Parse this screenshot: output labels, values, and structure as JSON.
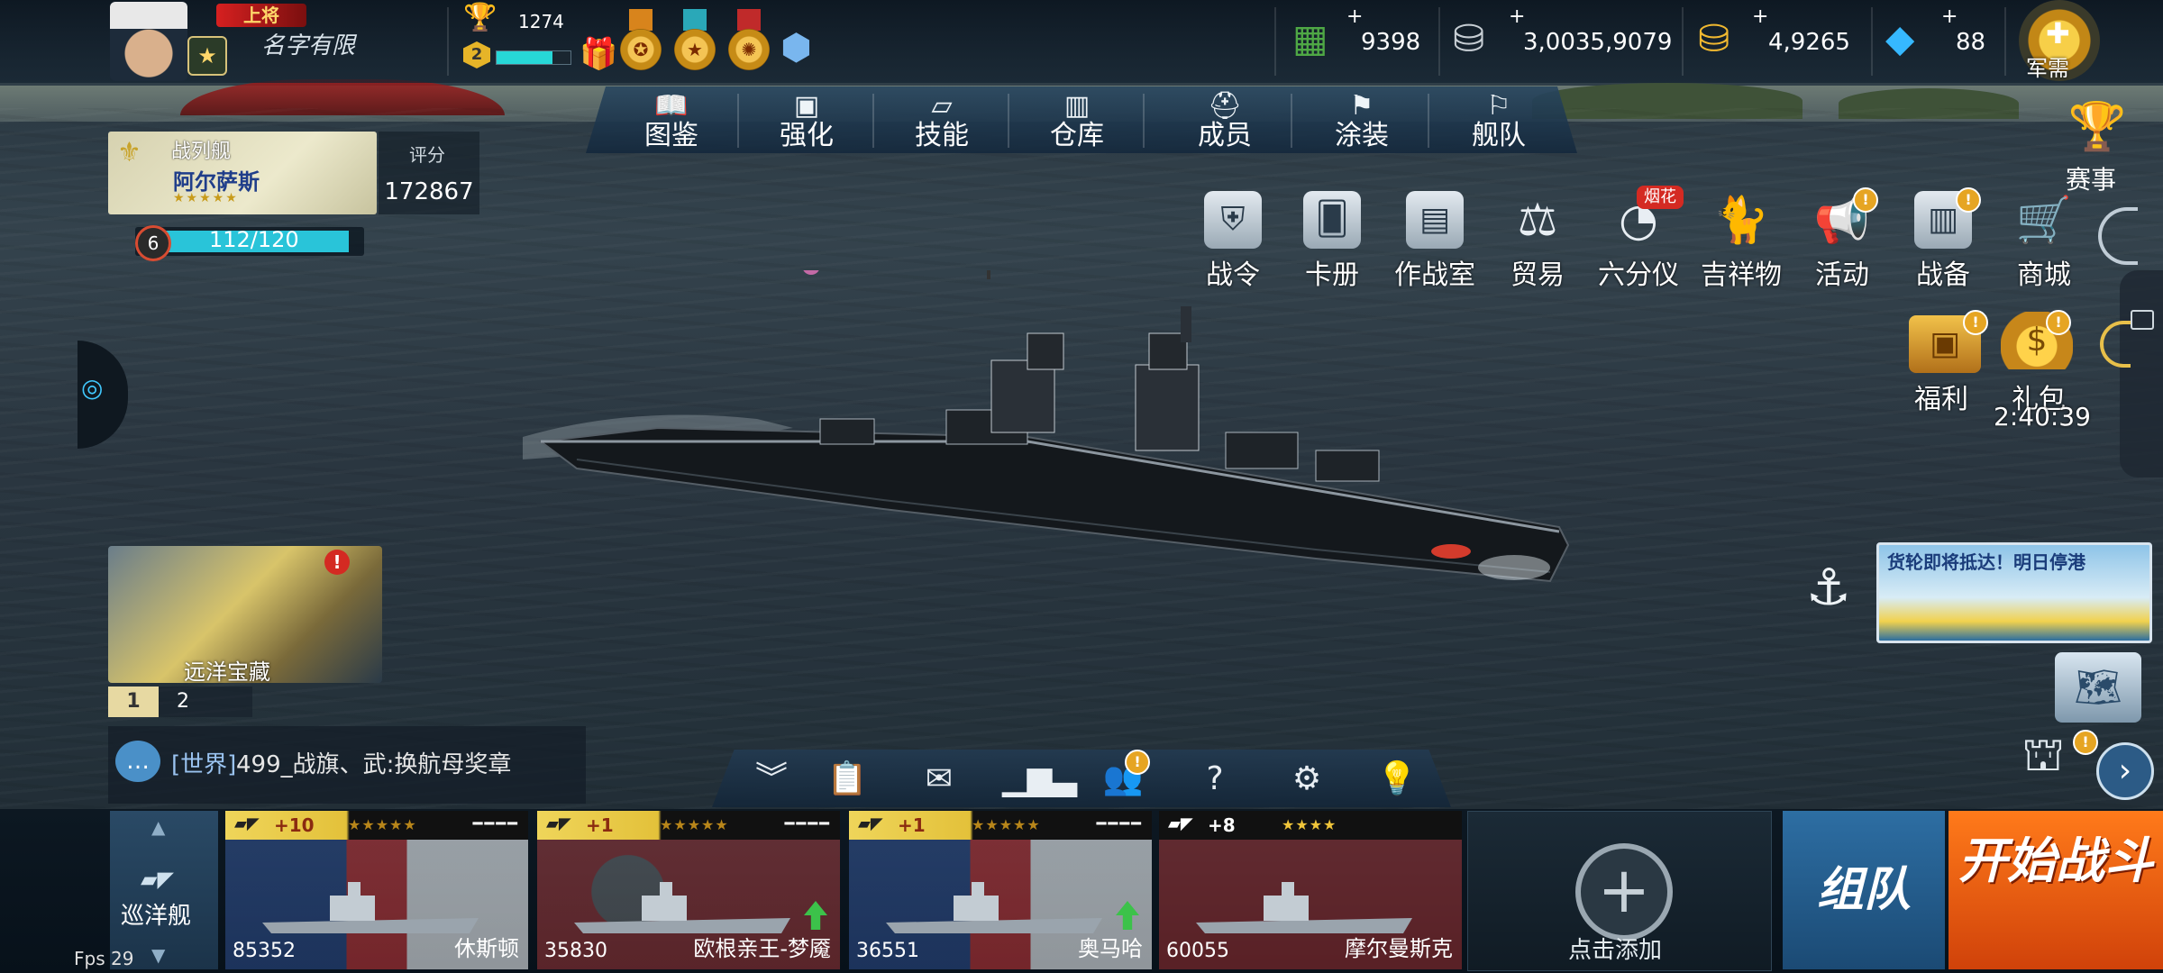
{
  "player": {
    "rank": "上将",
    "name": "名字有限",
    "trophy_count": "1274",
    "level": "2",
    "xp_fraction": 0.75
  },
  "currencies": [
    {
      "name": "cash",
      "icon": "cash-icon",
      "value": "9398",
      "plus": "+"
    },
    {
      "name": "silver",
      "icon": "silver-coins-icon",
      "value": "3,0035,9079",
      "plus": "+"
    },
    {
      "name": "gold",
      "icon": "gold-coins-icon",
      "value": "4,9265",
      "plus": "+"
    },
    {
      "name": "diamond",
      "icon": "diamond-icon",
      "value": "88",
      "plus": "+"
    }
  ],
  "military_supply_label": "军需",
  "nav_tabs": [
    {
      "icon": "book-icon",
      "label": "图鉴"
    },
    {
      "icon": "upgrade-icon",
      "label": "强化"
    },
    {
      "icon": "skill-icon",
      "label": "技能"
    },
    {
      "icon": "warehouse-icon",
      "label": "仓库"
    },
    {
      "icon": "crew-icon",
      "label": "成员"
    },
    {
      "icon": "paint-flag-icon",
      "label": "涂装"
    },
    {
      "icon": "fleet-flag-icon",
      "label": "舰队"
    }
  ],
  "ship_card": {
    "class": "战列舰",
    "name": "阿尔萨斯",
    "stars": "★★★★★",
    "score_label": "评分",
    "score": "172867",
    "level": "6",
    "hp_text": "112/120",
    "hp_fraction": 0.93
  },
  "tournament_label": "赛事",
  "functions_row1": [
    {
      "icon": "battle-pass-icon",
      "label": "战令"
    },
    {
      "icon": "card-album-icon",
      "label": "卡册"
    },
    {
      "icon": "war-room-icon",
      "label": "作战室"
    },
    {
      "icon": "trade-scale-icon",
      "label": "贸易"
    },
    {
      "icon": "sextant-icon",
      "label": "六分仪",
      "badge": "烟花"
    },
    {
      "icon": "mascot-icon",
      "label": "吉祥物"
    },
    {
      "icon": "event-horn-icon",
      "label": "活动",
      "dot": "!"
    },
    {
      "icon": "equipment-icon",
      "label": "战备",
      "dot": "!"
    },
    {
      "icon": "shop-cart-icon",
      "label": "商城"
    }
  ],
  "welfare_label": "福利",
  "gift_label": "礼包",
  "gift_timer": "2:40:39",
  "treasure_label": "远洋宝藏",
  "pages": [
    "1",
    "2"
  ],
  "chat": {
    "channel": "[世界]",
    "message": "499_战旗、武:换航母奖章"
  },
  "toolbar_icons": [
    "collapse-icon",
    "tasks-icon",
    "mail-icon",
    "ranking-icon",
    "friends-icon",
    "help-icon",
    "settings-icon",
    "tips-icon"
  ],
  "cargo_text": "货轮即将抵达！明日停港",
  "fleet_type_label": "巡洋舰",
  "fleet": [
    {
      "plus": "+10",
      "stars": "★★★★★",
      "dashes": "━━━━",
      "power": "85352",
      "name": "休斯顿",
      "upgrade": false,
      "flag": "us"
    },
    {
      "plus": "+1",
      "stars": "★★★★★",
      "dashes": "━━━━",
      "power": "35830",
      "name": "欧根亲王-梦魇",
      "upgrade": true,
      "flag": "de"
    },
    {
      "plus": "+1",
      "stars": "★★★★★",
      "dashes": "━━━━",
      "power": "36551",
      "name": "奥马哈",
      "upgrade": true,
      "flag": "us"
    },
    {
      "plus": "+8",
      "stars": "★★★★",
      "dashes": "",
      "power": "60055",
      "name": "摩尔曼斯克",
      "upgrade": false,
      "flag": "su"
    }
  ],
  "add_slot_label": "点击添加",
  "team_label": "组队",
  "start_label": "开始战斗",
  "fps": "Fps 29",
  "colors": {
    "accent_cyan": "#27d7d7",
    "start_orange": "#ff7a1a",
    "team_blue": "#2d6ea3",
    "alert_orange": "#e6a523",
    "alert_red": "#d42a22"
  }
}
